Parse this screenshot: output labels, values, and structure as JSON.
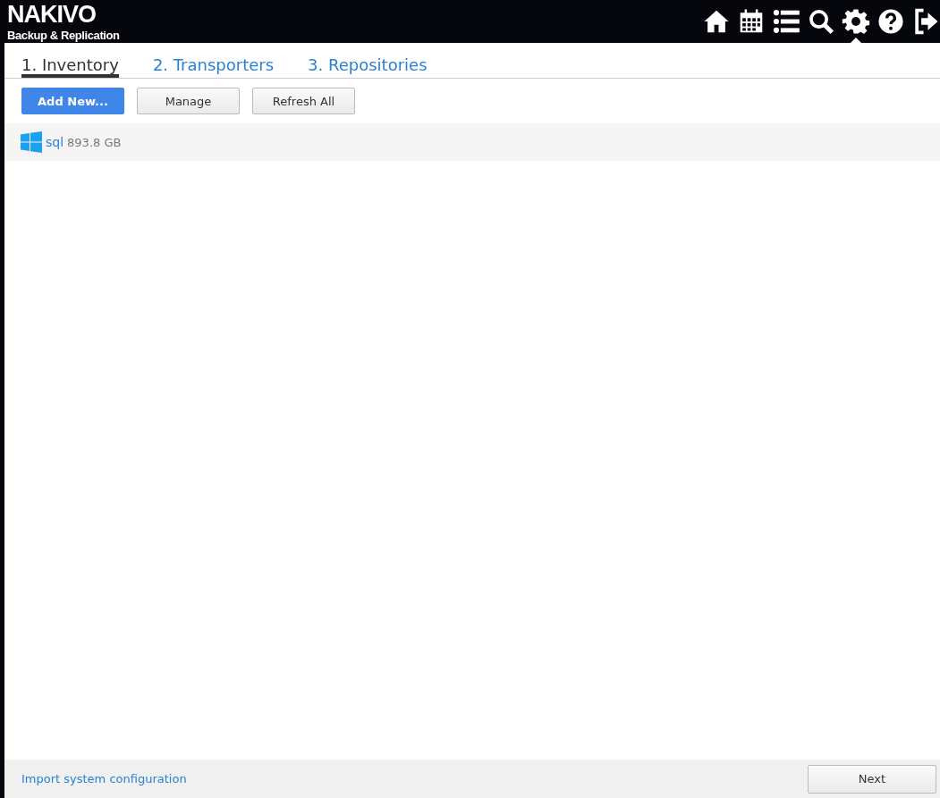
{
  "header": {
    "logo": {
      "name": "NAKIVO",
      "subtitle": "Backup & Replication"
    },
    "nav": [
      {
        "kind": "home",
        "selected": false
      },
      {
        "kind": "calendar",
        "selected": false
      },
      {
        "kind": "list",
        "selected": false
      },
      {
        "kind": "search",
        "selected": false
      },
      {
        "kind": "settings",
        "selected": true
      },
      {
        "kind": "help",
        "selected": false
      },
      {
        "kind": "logout",
        "selected": false
      }
    ]
  },
  "tabs": [
    {
      "label": "1. Inventory",
      "selected": true
    },
    {
      "label": "2. Transporters",
      "selected": false
    },
    {
      "label": "3. Repositories",
      "selected": false
    }
  ],
  "toolbar": [
    {
      "label": "Add New...",
      "kind": "primary"
    },
    {
      "label": "Manage",
      "kind": "default"
    },
    {
      "label": "Refresh All",
      "kind": "default"
    }
  ],
  "inventory": [
    {
      "kind": "windows",
      "name": "sql",
      "size": "893.8 GB"
    }
  ],
  "footer": {
    "link": "Import system configuration",
    "button": "Next"
  }
}
